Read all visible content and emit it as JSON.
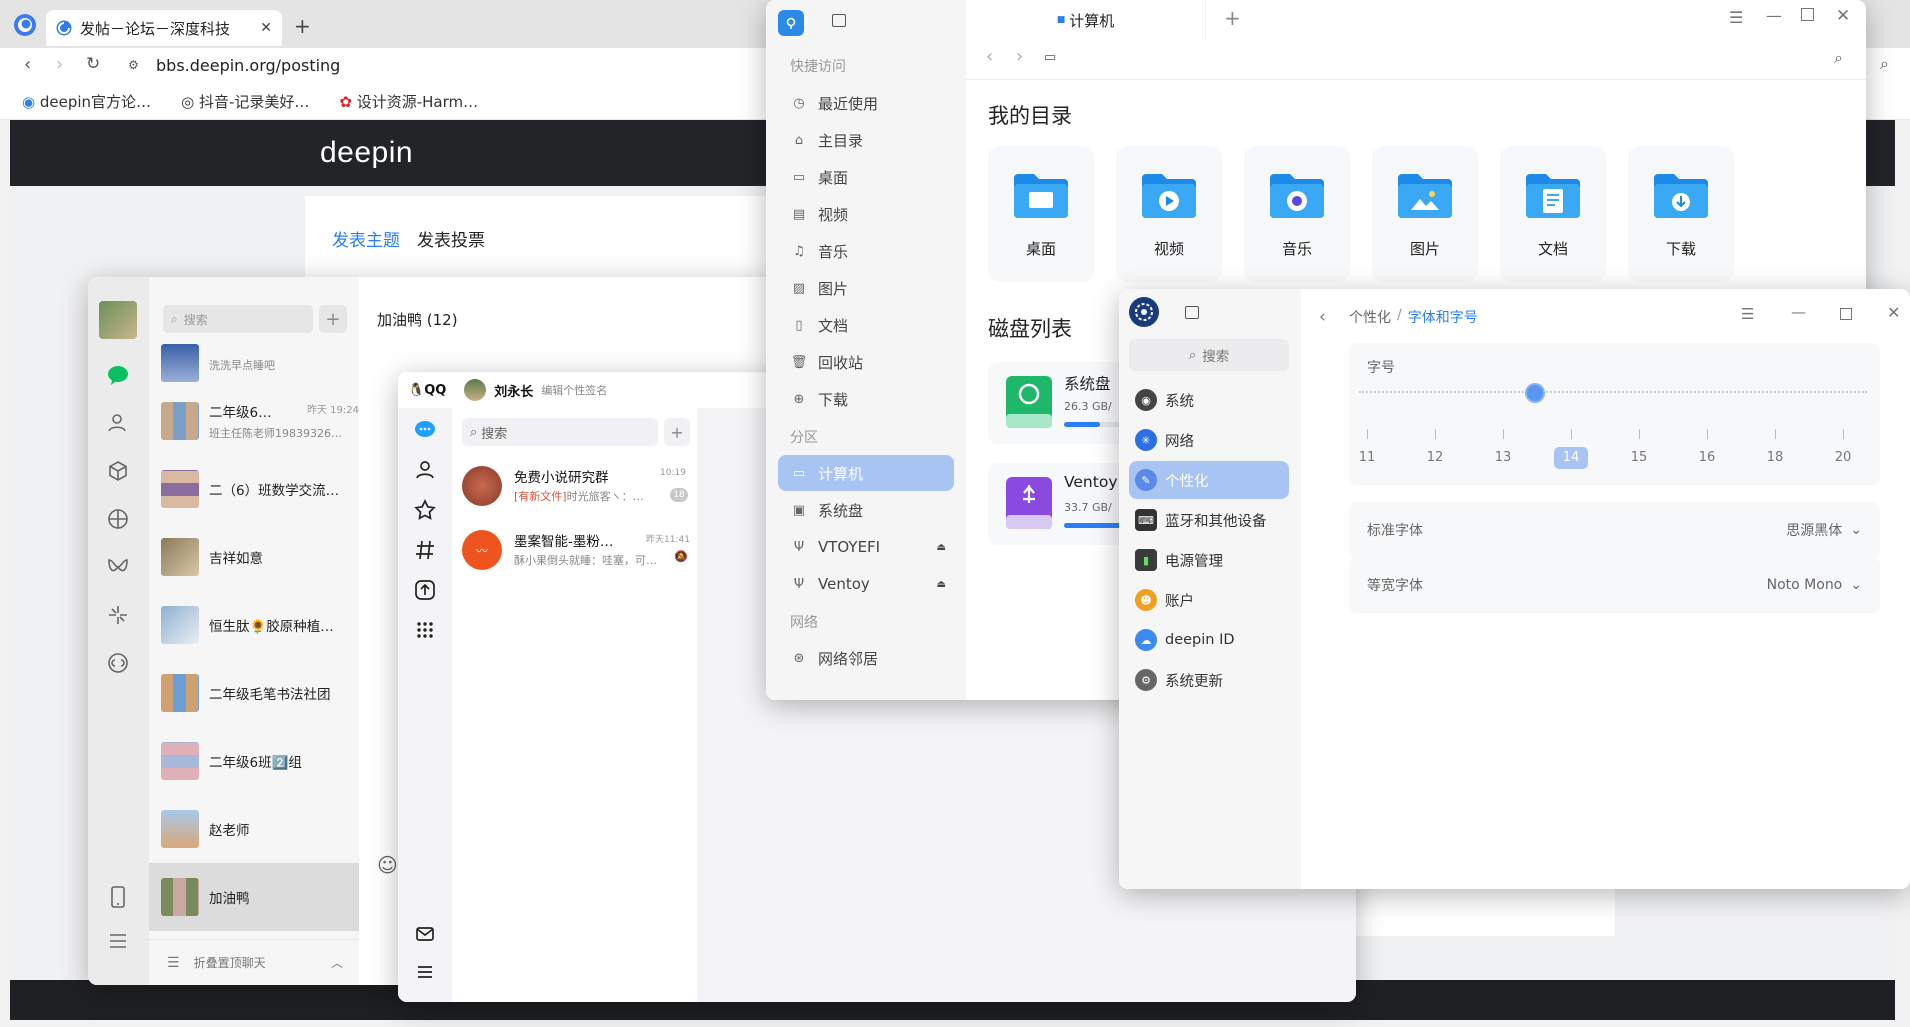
{
  "browser": {
    "tab_title": "发帖－论坛－深度科技",
    "url": "bbs.deepin.org/posting",
    "bookmarks": [
      "deepin官方论…",
      "抖音-记录美好…",
      "设计资源-Harm…"
    ],
    "logo": "deepin",
    "post_tabs": [
      "发表主题",
      "发表投票"
    ]
  },
  "chat": {
    "search_placeholder": "搜索",
    "current_chat": "加油鸭 (12)",
    "items": [
      {
        "name": "…",
        "sub": "洗洗早点睡吧",
        "time": ""
      },
      {
        "name": "二年级6…",
        "sub": "班主任陈老师19839326…",
        "time": "昨天 19:24"
      },
      {
        "name": "二（6）班数学交流…",
        "sub": "",
        "time": ""
      },
      {
        "name": "吉祥如意",
        "sub": "",
        "time": ""
      },
      {
        "name": "恒生肽🌻胶原种植…",
        "sub": "",
        "time": ""
      },
      {
        "name": "二年级毛笔书法社团",
        "sub": "",
        "time": ""
      },
      {
        "name": "二年级6班2️⃣组",
        "sub": "",
        "time": ""
      },
      {
        "name": "赵老师",
        "sub": "",
        "time": ""
      },
      {
        "name": "加油鸭",
        "sub": "",
        "time": ""
      }
    ],
    "fold_label": "折叠置顶聊天"
  },
  "qq": {
    "app_name": "QQ",
    "user_name": "刘永长",
    "signature": "编辑个性签名",
    "search_placeholder": "搜索",
    "items": [
      {
        "name": "免费小说研究群",
        "tag": "[有新文件]",
        "sub": "时光旅客ヽ：…",
        "time": "10:19",
        "badge": "18"
      },
      {
        "name": "墨案智能-墨粉…",
        "tag": "",
        "sub": "酥小果倒头就睡：哇塞，可…",
        "time": "昨天11:41",
        "badge": ""
      }
    ]
  },
  "files": {
    "tab_title": "计算机",
    "sections": {
      "quick": "快捷访问",
      "partition": "分区",
      "network": "网络"
    },
    "quick_items": [
      "最近使用",
      "主目录",
      "桌面",
      "视频",
      "音乐",
      "图片",
      "文档",
      "回收站",
      "下载"
    ],
    "partition_items": [
      "计算机",
      "系统盘",
      "VTOYEFI",
      "Ventoy"
    ],
    "network_items": [
      "网络邻居"
    ],
    "my_dirs_title": "我的目录",
    "folders": [
      "桌面",
      "视频",
      "音乐",
      "图片",
      "文档",
      "下载"
    ],
    "disk_title": "磁盘列表",
    "disks": [
      {
        "name": "系统盘",
        "size": "26.3 GB/"
      },
      {
        "name": "Ventoy",
        "size": "33.7 GB/"
      }
    ]
  },
  "control": {
    "search_placeholder": "搜索",
    "breadcrumb_parent": "个性化",
    "breadcrumb_sep": "/",
    "breadcrumb_current": "字体和字号",
    "menu": [
      "系统",
      "网络",
      "个性化",
      "蓝牙和其他设备",
      "电源管理",
      "账户",
      "deepin ID",
      "系统更新"
    ],
    "font_size_label": "字号",
    "font_size_ticks": [
      "11",
      "12",
      "13",
      "14",
      "15",
      "16",
      "18",
      "20"
    ],
    "font_size_value": "14",
    "standard_font_label": "标准字体",
    "standard_font_value": "思源黑体",
    "mono_font_label": "等宽字体",
    "mono_font_value": "Noto Mono"
  },
  "colors": {
    "accent": "#2b7ff5",
    "active_bg": "#a8c4f3",
    "wechat_green": "#07c160"
  }
}
